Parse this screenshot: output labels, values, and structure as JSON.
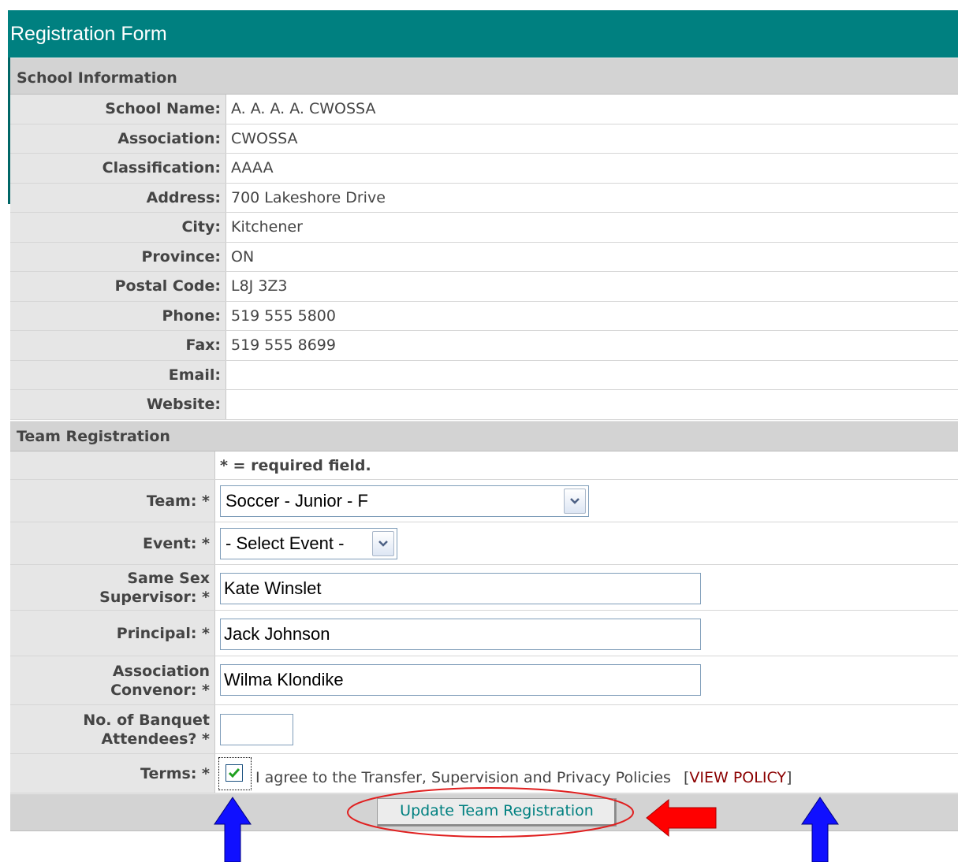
{
  "title": "Registration Form",
  "school_section": {
    "heading": "School Information",
    "fields": [
      {
        "label": "School Name:",
        "value": "A. A. A. A. CWOSSA"
      },
      {
        "label": "Association:",
        "value": "CWOSSA"
      },
      {
        "label": "Classification:",
        "value": "AAAA"
      },
      {
        "label": "Address:",
        "value": "700 Lakeshore Drive"
      },
      {
        "label": "City:",
        "value": "Kitchener"
      },
      {
        "label": "Province:",
        "value": "ON"
      },
      {
        "label": "Postal Code:",
        "value": "L8J 3Z3"
      },
      {
        "label": "Phone:",
        "value": "519 555 5800"
      },
      {
        "label": "Fax:",
        "value": "519 555 8699"
      },
      {
        "label": "Email:",
        "value": ""
      },
      {
        "label": "Website:",
        "value": ""
      }
    ]
  },
  "team_section": {
    "heading": "Team Registration",
    "required_note": "* = required field.",
    "team": {
      "label": "Team: *",
      "value": "Soccer - Junior - F"
    },
    "event": {
      "label": "Event: *",
      "value": "- Select Event -"
    },
    "supervisor": {
      "label_line1": "Same Sex",
      "label_line2": "Supervisor: *",
      "value": "Kate Winslet"
    },
    "principal": {
      "label": "Principal: *",
      "value": "Jack Johnson"
    },
    "convenor": {
      "label_line1": "Association",
      "label_line2": "Convenor: *",
      "value": "Wilma Klondike"
    },
    "banquet": {
      "label_line1": "No. of Banquet",
      "label_line2": "Attendees? *",
      "value": ""
    },
    "terms": {
      "label": "Terms: *",
      "checked": true,
      "text": "I agree to the Transfer, Supervision and Privacy Policies",
      "link_open": "[",
      "link_text": "VIEW POLICY",
      "link_close": "]"
    },
    "submit_label": "Update Team Registration"
  },
  "annotations": {
    "arrow_color_blue": "#0000ff",
    "arrow_color_red": "#ff0000",
    "circle_color": "#e02020"
  },
  "colors": {
    "header_bg": "#008080",
    "section_bg": "#d3d3d3",
    "label_bg": "#e6e6e6",
    "link": "#8b0000"
  }
}
